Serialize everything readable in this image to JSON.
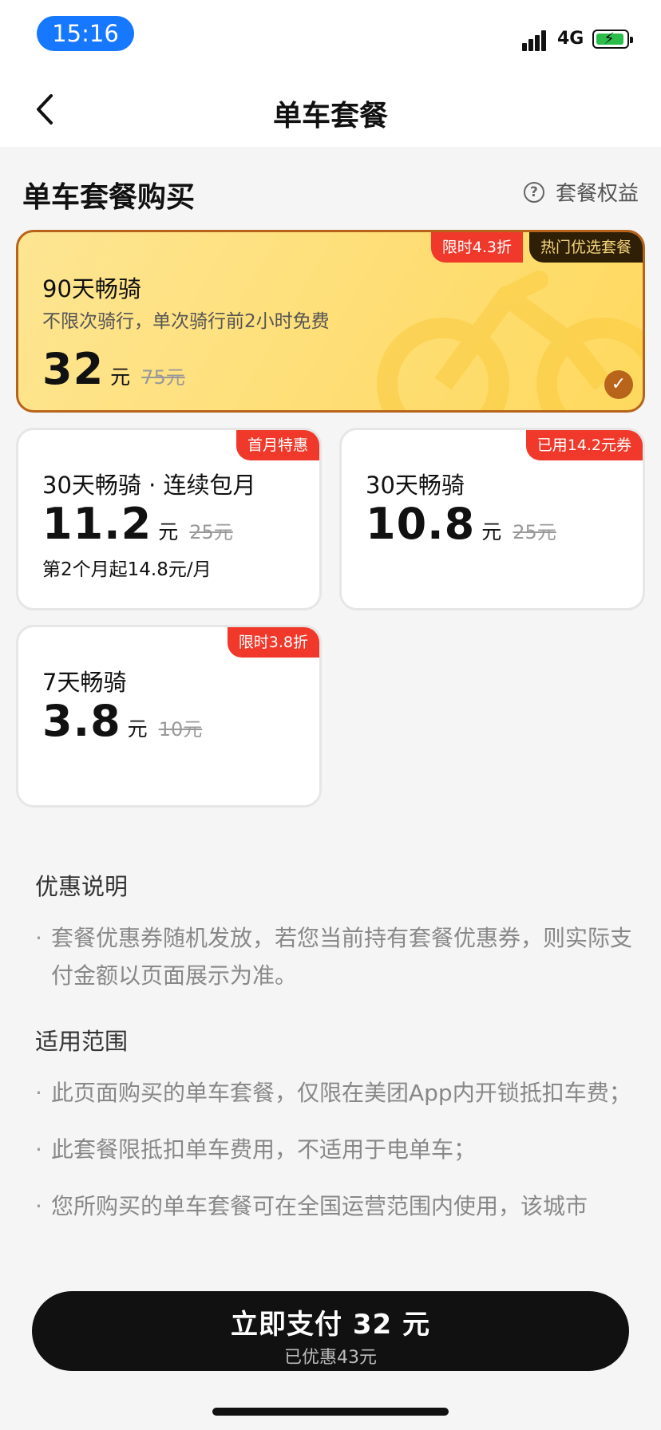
{
  "status": {
    "time": "15:16",
    "network": "4G"
  },
  "nav": {
    "title": "单车套餐"
  },
  "section": {
    "title": "单车套餐购买",
    "benefit_label": "套餐权益",
    "benefit_icon": "question-circle-icon"
  },
  "plans": [
    {
      "name": "90天畅骑",
      "desc": "不限次骑行，单次骑行前2小时免费",
      "price": "32",
      "unit": "元",
      "original": "75元",
      "tags": [
        "限时4.3折",
        "热门优选套餐"
      ],
      "selected": true
    },
    {
      "name": "30天畅骑 · 连续包月",
      "price": "11.2",
      "unit": "元",
      "original": "25元",
      "note": "第2个月起14.8元/月",
      "tag": "首月特惠"
    },
    {
      "name": "30天畅骑",
      "price": "10.8",
      "unit": "元",
      "original": "25元",
      "tag": "已用14.2元券"
    },
    {
      "name": "7天畅骑",
      "price": "3.8",
      "unit": "元",
      "original": "10元",
      "tag": "限时3.8折"
    }
  ],
  "notes": {
    "discount_title": "优惠说明",
    "discount_items": [
      "套餐优惠券随机发放，若您当前持有套餐优惠券，则实际支付金额以页面展示为准。"
    ],
    "scope_title": "适用范围",
    "scope_items": [
      "此页面购买的单车套餐，仅限在美团App内开锁抵扣车费；",
      "此套餐限抵扣单车费用，不适用于电单车；",
      "您所购买的单车套餐可在全国运营范围内使用，该城市"
    ]
  },
  "pay": {
    "label": "立即支付 32 元",
    "saved": "已优惠43元"
  },
  "colors": {
    "accent_blue": "#1677ff",
    "tag_red": "#f0392b",
    "featured_bg": "#ffd95e",
    "featured_border": "#b7641a",
    "pay_bg": "#111111"
  }
}
